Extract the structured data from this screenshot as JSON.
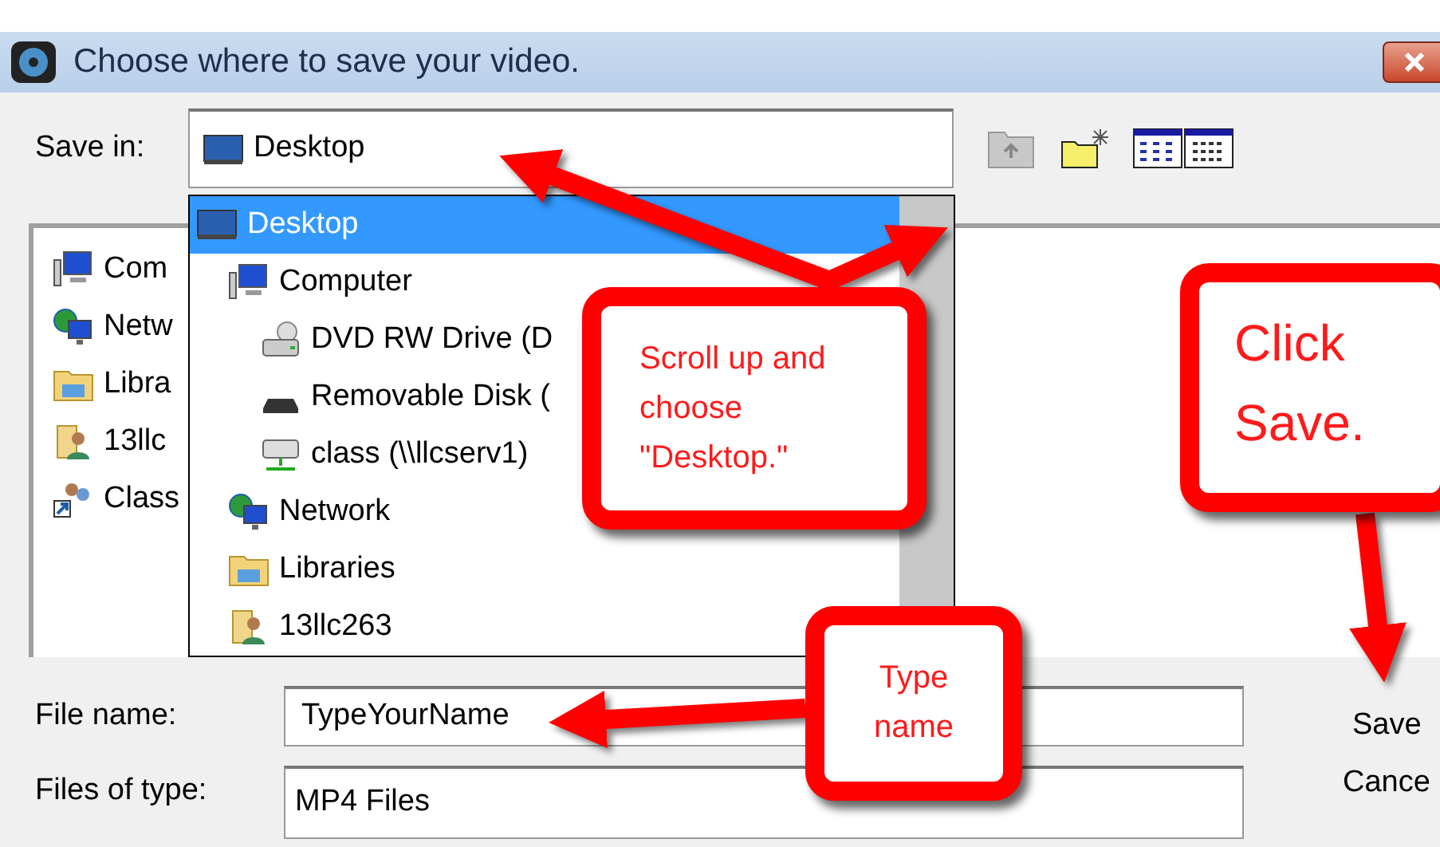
{
  "window": {
    "title": "Choose where to save your video."
  },
  "save_in": {
    "label": "Save in:",
    "value": "Desktop",
    "kind": "desktop"
  },
  "toolbar": [
    {
      "kind": "up-folder",
      "disabled": true
    },
    {
      "kind": "new-folder",
      "disabled": false
    },
    {
      "kind": "view-toggle",
      "disabled": false
    }
  ],
  "file_list": [
    {
      "label": "Com",
      "kind": "computer"
    },
    {
      "label": "Netw",
      "kind": "network"
    },
    {
      "label": "Libra",
      "kind": "libraries"
    },
    {
      "label": "13llc",
      "kind": "user-folder"
    },
    {
      "label": "Class",
      "kind": "shortcut"
    }
  ],
  "dropdown": [
    {
      "label": "Desktop",
      "kind": "desktop",
      "selected": true,
      "children": [
        {
          "label": "Computer",
          "kind": "computer",
          "selected": false,
          "children": [
            {
              "label": "DVD RW Drive (D",
              "kind": "dvd",
              "selected": false
            },
            {
              "label": "Removable Disk (",
              "kind": "removable",
              "selected": false
            },
            {
              "label": "class (\\\\llcserv1)",
              "kind": "net-drive",
              "selected": false
            }
          ]
        },
        {
          "label": "Network",
          "kind": "network",
          "selected": false
        },
        {
          "label": "Libraries",
          "kind": "libraries",
          "selected": false
        },
        {
          "label": "13llc263",
          "kind": "user-folder",
          "selected": false
        }
      ]
    }
  ],
  "file_name": {
    "label": "File name:",
    "value": "TypeYourName"
  },
  "file_type": {
    "label": "Files of type:",
    "value": "MP4 Files"
  },
  "buttons": [
    "Save",
    "Cance"
  ],
  "callouts": [
    {
      "text": "Scroll up and choose \"Desktop.\"",
      "kind": "scroll"
    },
    {
      "text": "Click Save.",
      "kind": "save"
    },
    {
      "text": "Type name",
      "kind": "type"
    }
  ]
}
